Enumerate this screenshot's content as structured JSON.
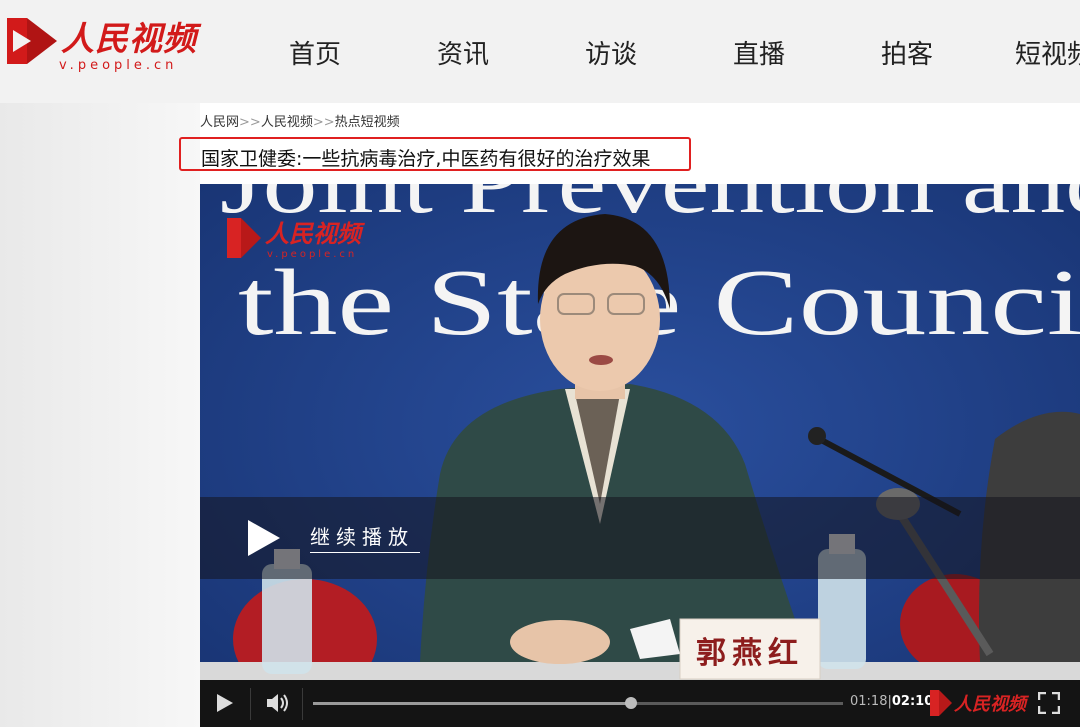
{
  "header": {
    "logo_text": "人民视频",
    "logo_sub": "v.people.cn",
    "nav": [
      "首页",
      "资讯",
      "访谈",
      "直播",
      "拍客",
      "短视频"
    ]
  },
  "breadcrumb": [
    "人民网",
    "人民视频",
    "热点短视频"
  ],
  "breadcrumb_sep": ">>",
  "title": "国家卫健委:一些抗病毒治疗,中医药有很好的治疗效果",
  "video": {
    "backdrop_line1": "Joint Prevention and",
    "backdrop_line2": "the State Council",
    "watermark_text": "人民视频",
    "watermark_sub": "v.people.cn",
    "resume_label": "继续播放",
    "nameplate": "郭燕红",
    "current_time": "01:18",
    "total_time": "02:10",
    "progress": 0.6,
    "controls_logo": "人民视频",
    "icons": {
      "play": "play-icon",
      "volume": "volume-icon",
      "fullscreen": "fullscreen-icon"
    }
  },
  "colors": {
    "brand_red": "#d21a1a",
    "highlight_border": "#e02020",
    "backdrop_blue": "#1f3f86"
  }
}
